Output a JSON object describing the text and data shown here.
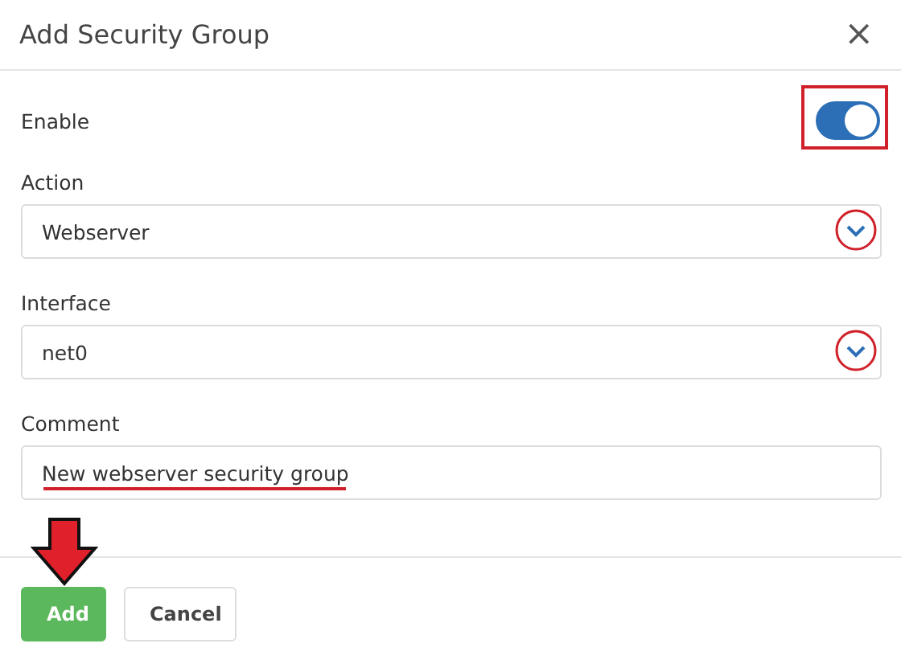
{
  "dialog": {
    "title": "Add Security Group",
    "close": "×"
  },
  "fields": [
    {
      "kind": "toggle",
      "label": "Enable",
      "on": true
    },
    {
      "kind": "select",
      "label": "Action",
      "value": "Webserver"
    },
    {
      "kind": "select",
      "label": "Interface",
      "value": "net0"
    },
    {
      "kind": "text",
      "label": "Comment",
      "value": "New webserver security group"
    }
  ],
  "buttons": [
    {
      "label": "Add",
      "kind": "primary"
    },
    {
      "label": "Cancel",
      "kind": "secondary"
    }
  ]
}
